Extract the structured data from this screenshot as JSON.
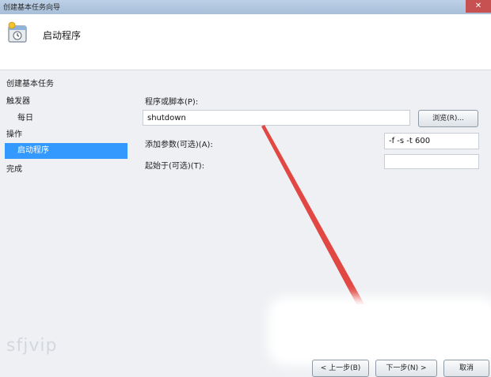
{
  "window": {
    "title": "创建基本任务向导",
    "close_glyph": "✕"
  },
  "header": {
    "title": "启动程序",
    "icon": "task-clock-icon"
  },
  "sidebar": {
    "steps": [
      {
        "label": "创建基本任务",
        "active": false
      },
      {
        "label": "触发器",
        "active": false
      },
      {
        "label": "每日",
        "active": false
      },
      {
        "label": "操作",
        "active": false
      },
      {
        "label": "启动程序",
        "active": true
      },
      {
        "label": "完成",
        "active": false
      }
    ]
  },
  "form": {
    "program_label": "程序或脚本(P):",
    "program_value": "shutdown",
    "browse_button": "浏览(R)...",
    "args_label": "添加参数(可选)(A):",
    "args_value": "-f -s -t 600",
    "startin_label": "起始于(可选)(T):",
    "startin_value": ""
  },
  "footer": {
    "back_button": "< 上一步(B)",
    "next_button": "下一步(N) >",
    "cancel_button": "取消"
  },
  "watermark": "sfjvip",
  "colors": {
    "accent": "#3399ff",
    "pointer": "#e0302a",
    "titlebar": "#b3c8e0"
  }
}
